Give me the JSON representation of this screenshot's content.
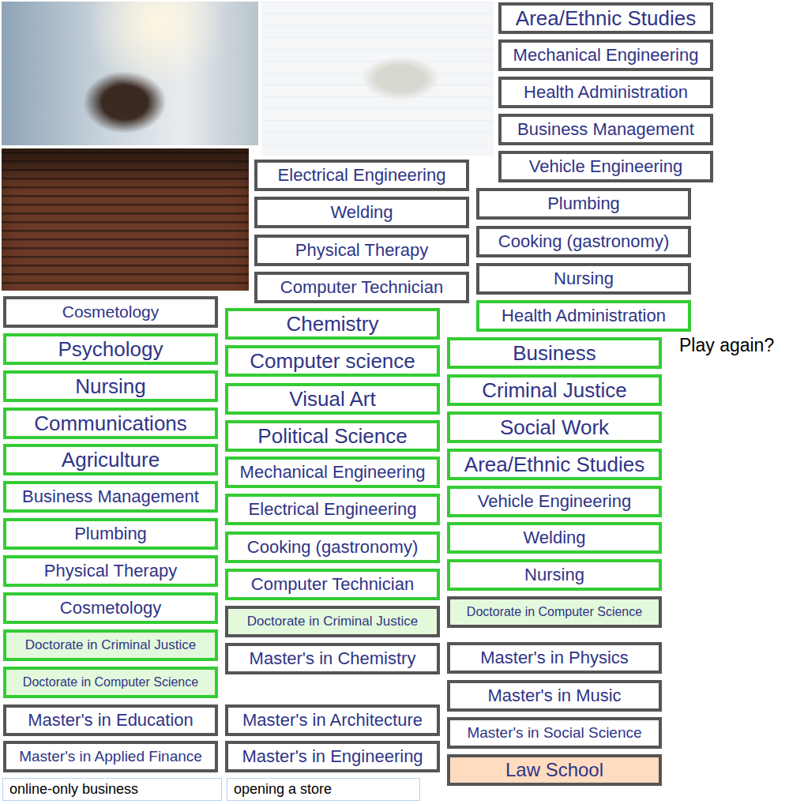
{
  "falling_tiles": [
    {
      "label": "Area/Ethnic Studies",
      "matched": false,
      "color": "#ffffff"
    },
    {
      "label": "Mechanical Engineering",
      "matched": false,
      "color": "#ffffff"
    },
    {
      "label": "Health Administration",
      "matched": false,
      "color": "#ffffff"
    },
    {
      "label": "Business Management",
      "matched": false,
      "color": "#ffffff"
    },
    {
      "label": "Vehicle Engineering",
      "matched": false,
      "color": "#ffffff"
    },
    {
      "label": "Electrical Engineering",
      "matched": false,
      "color": "#ffffff"
    },
    {
      "label": "Welding",
      "matched": false,
      "color": "#ffffff"
    },
    {
      "label": "Physical Therapy",
      "matched": false,
      "color": "#ffffff"
    },
    {
      "label": "Computer Technician",
      "matched": false,
      "color": "#ffffff"
    },
    {
      "label": "Plumbing",
      "matched": false,
      "color": "#ffffff"
    },
    {
      "label": "Cooking (gastronomy)",
      "matched": false,
      "color": "#ffffff"
    },
    {
      "label": "Nursing",
      "matched": false,
      "color": "#ffffff"
    },
    {
      "label": "Health Administration",
      "matched": true,
      "color": "#ffffff"
    }
  ],
  "stacks": [
    {
      "tiles": [
        {
          "label": "Cosmetology",
          "matched": false,
          "color": "#ffffff"
        },
        {
          "label": "Psychology",
          "matched": true,
          "color": "#ffffff"
        },
        {
          "label": "Nursing",
          "matched": true,
          "color": "#ffffff"
        },
        {
          "label": "Communications",
          "matched": true,
          "color": "#ffffff"
        },
        {
          "label": "Agriculture",
          "matched": true,
          "color": "#ffffff"
        },
        {
          "label": "Business Management",
          "matched": true,
          "color": "#ffffff"
        },
        {
          "label": "Plumbing",
          "matched": true,
          "color": "#ffffff"
        },
        {
          "label": "Physical Therapy",
          "matched": true,
          "color": "#ffffff"
        },
        {
          "label": "Cosmetology",
          "matched": true,
          "color": "#ffffff"
        },
        {
          "label": "Doctorate in Criminal Justice",
          "matched": true,
          "color": "#e4f9dc"
        },
        {
          "label": "Doctorate in Computer Science",
          "matched": true,
          "color": "#e4f9dc"
        },
        {
          "label": "Master's in Education",
          "matched": false,
          "color": "#ffffff"
        },
        {
          "label": "Master's in Applied Finance",
          "matched": false,
          "color": "#ffffff"
        }
      ]
    },
    {
      "tiles": [
        {
          "label": "Chemistry",
          "matched": true,
          "color": "#ffffff"
        },
        {
          "label": "Computer science",
          "matched": true,
          "color": "#ffffff"
        },
        {
          "label": "Visual Art",
          "matched": true,
          "color": "#ffffff"
        },
        {
          "label": "Political Science",
          "matched": true,
          "color": "#ffffff"
        },
        {
          "label": "Mechanical Engineering",
          "matched": true,
          "color": "#ffffff"
        },
        {
          "label": "Electrical Engineering",
          "matched": true,
          "color": "#ffffff"
        },
        {
          "label": "Cooking (gastronomy)",
          "matched": true,
          "color": "#ffffff"
        },
        {
          "label": "Computer Technician",
          "matched": true,
          "color": "#ffffff"
        },
        {
          "label": "Doctorate in Criminal Justice",
          "matched": false,
          "color": "#e4f9dc"
        },
        {
          "label": "Master's in Chemistry",
          "matched": false,
          "color": "#ffffff"
        },
        {
          "label": "Master's in Architecture",
          "matched": false,
          "color": "#ffffff"
        },
        {
          "label": "Master's in Engineering",
          "matched": false,
          "color": "#ffffff"
        }
      ]
    },
    {
      "tiles": [
        {
          "label": "Business",
          "matched": true,
          "color": "#ffffff"
        },
        {
          "label": "Criminal Justice",
          "matched": true,
          "color": "#ffffff"
        },
        {
          "label": "Social Work",
          "matched": true,
          "color": "#ffffff"
        },
        {
          "label": "Area/Ethnic Studies",
          "matched": true,
          "color": "#ffffff"
        },
        {
          "label": "Vehicle Engineering",
          "matched": true,
          "color": "#ffffff"
        },
        {
          "label": "Welding",
          "matched": true,
          "color": "#ffffff"
        },
        {
          "label": "Nursing",
          "matched": true,
          "color": "#ffffff"
        },
        {
          "label": "Doctorate in Computer Science",
          "matched": false,
          "color": "#e4f9dc"
        },
        {
          "label": "Master's in Physics",
          "matched": false,
          "color": "#ffffff"
        },
        {
          "label": "Master's in Music",
          "matched": false,
          "color": "#ffffff"
        },
        {
          "label": "Master's in Social Science",
          "matched": false,
          "color": "#ffffff"
        },
        {
          "label": "Law School",
          "matched": false,
          "color": "#ffdcbf"
        }
      ]
    }
  ],
  "play_again": "Play again?",
  "answer_options": [
    {
      "label": "online-only business"
    },
    {
      "label": "opening a store"
    }
  ]
}
